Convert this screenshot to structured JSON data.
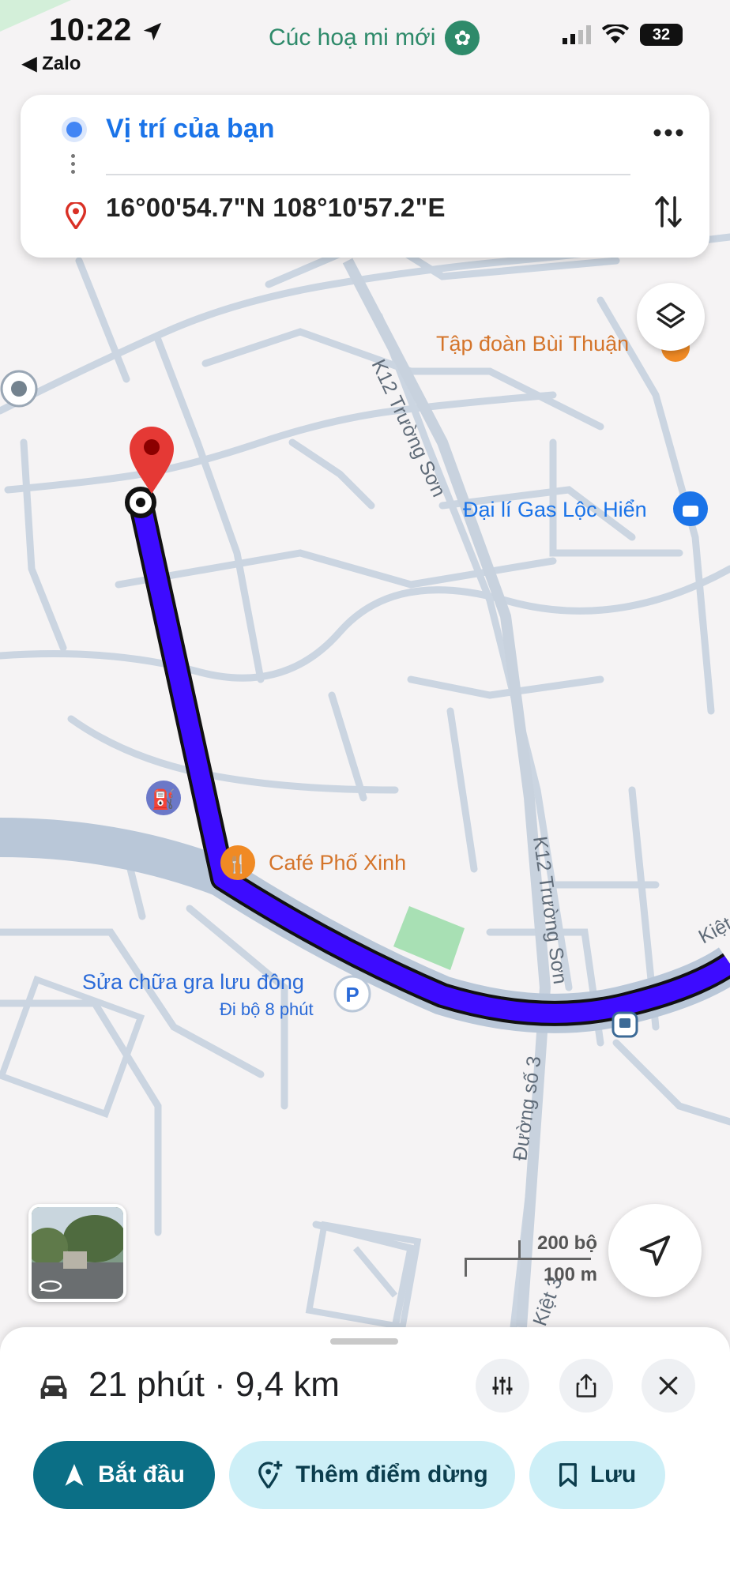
{
  "status_bar": {
    "time": "10:22",
    "back_app": "◀ Zalo",
    "battery": "32",
    "banner_label": "Cúc hoạ mi mới"
  },
  "directions": {
    "origin": "Vị trí của bạn",
    "destination": "16°00'54.7\"N 108°10'57.2\"E"
  },
  "map": {
    "pois": [
      {
        "name": "Tập đoàn Bùi Thuận",
        "color": "#d4742a"
      },
      {
        "name": "Đại lí Gas Lộc Hiển",
        "color": "#1a73e8"
      },
      {
        "name": "Café Phố Xinh",
        "color": "#d4742a"
      },
      {
        "name": "Sửa chữa gra lưu đông",
        "color": "#1a73e8"
      }
    ],
    "walk_note": "Đi bộ 8 phút",
    "streets": [
      "K12 Trường Sơn",
      "K12 Trường Sơn",
      "Đường số 3",
      "Kiệt 3",
      "Kiệt"
    ],
    "route_color": "#3d0bff",
    "scale_top": "200 bộ",
    "scale_bottom": "100 m"
  },
  "sheet": {
    "summary": "21 phút · 9,4 km",
    "start_label": "Bắt đầu",
    "add_stop_label": "Thêm điểm dừng",
    "save_label": "Lưu"
  }
}
